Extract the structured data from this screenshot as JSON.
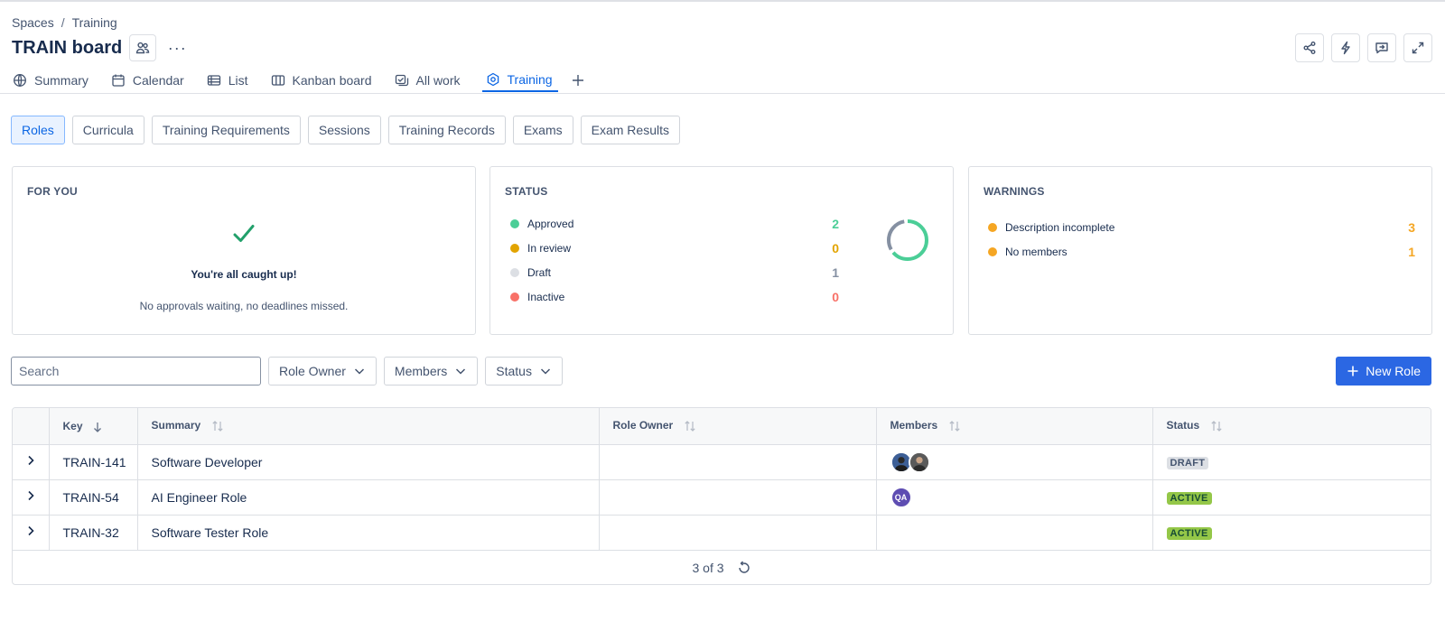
{
  "breadcrumb": {
    "spaces": "Spaces",
    "separator": "/",
    "training": "Training"
  },
  "page": {
    "title": "TRAIN board",
    "more": "···"
  },
  "nav_tabs": [
    {
      "label": "Summary",
      "icon": "globe-icon"
    },
    {
      "label": "Calendar",
      "icon": "calendar-icon"
    },
    {
      "label": "List",
      "icon": "list-icon"
    },
    {
      "label": "Kanban board",
      "icon": "board-icon"
    },
    {
      "label": "All work",
      "icon": "all-work-icon"
    },
    {
      "label": "Training",
      "icon": "training-icon",
      "active": true
    }
  ],
  "sub_tabs": [
    "Roles",
    "Curricula",
    "Training Requirements",
    "Sessions",
    "Training Records",
    "Exams",
    "Exam Results"
  ],
  "for_you": {
    "title": "FOR YOU",
    "heading": "You're all caught up!",
    "message": "No approvals waiting, no deadlines missed."
  },
  "status": {
    "title": "STATUS",
    "items": [
      {
        "label": "Approved",
        "value": "2",
        "color": "#4bce97"
      },
      {
        "label": "In review",
        "value": "0",
        "color": "#e2a400"
      },
      {
        "label": "Draft",
        "value": "1",
        "color": "#dcdfe4",
        "value_color": "#8590a2"
      },
      {
        "label": "Inactive",
        "value": "0",
        "color": "#f87168"
      }
    ]
  },
  "warnings": {
    "title": "WARNINGS",
    "items": [
      {
        "label": "Description incomplete",
        "value": "3",
        "color": "#f5a623"
      },
      {
        "label": "No members",
        "value": "1",
        "color": "#f5a623"
      }
    ]
  },
  "filters": {
    "search_placeholder": "Search",
    "role_owner": "Role Owner",
    "members": "Members",
    "status": "Status",
    "new_role": "New Role"
  },
  "table": {
    "columns": {
      "key": "Key",
      "summary": "Summary",
      "role_owner": "Role Owner",
      "members": "Members",
      "status": "Status"
    },
    "rows": [
      {
        "key": "TRAIN-141",
        "summary": "Software Developer",
        "role_owner": "",
        "status": "DRAFT"
      },
      {
        "key": "TRAIN-54",
        "summary": "AI Engineer Role",
        "role_owner": "",
        "members_initials": "QA",
        "status": "ACTIVE"
      },
      {
        "key": "TRAIN-32",
        "summary": "Software Tester Role",
        "role_owner": "",
        "status": "ACTIVE"
      }
    ],
    "footer_count": "3 of 3"
  },
  "colors": {
    "accent": "#0c66e4",
    "primary_button": "#2b67e3",
    "check": "#22a06b"
  }
}
